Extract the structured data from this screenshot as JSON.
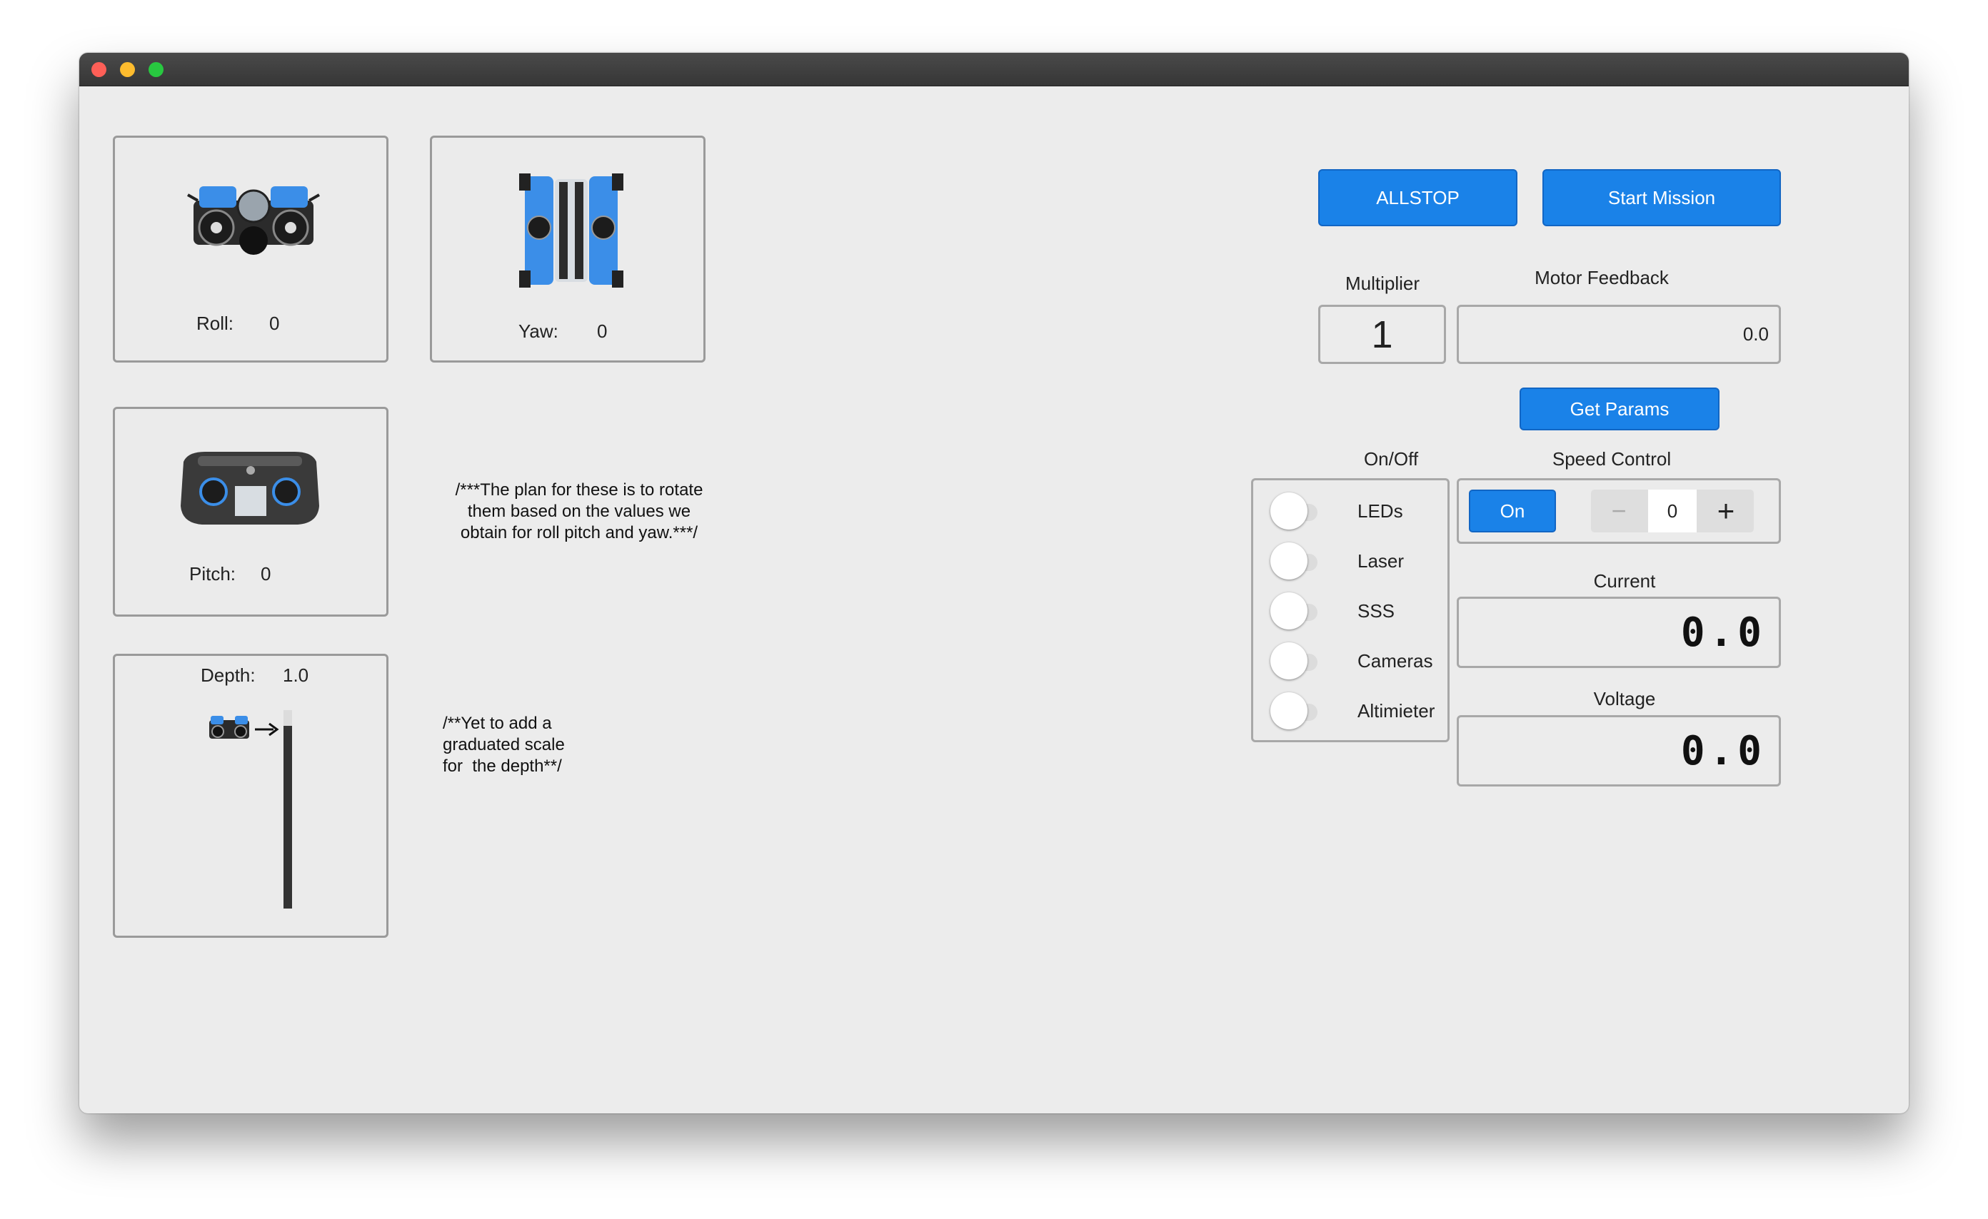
{
  "gauges": {
    "roll": {
      "label": "Roll:",
      "value": "0"
    },
    "yaw": {
      "label": "Yaw:",
      "value": "0"
    },
    "pitch": {
      "label": "Pitch:",
      "value": "0"
    },
    "depth": {
      "label": "Depth:",
      "value": "1.0"
    }
  },
  "notes": {
    "rotation_note": "/***The plan for these is to rotate\nthem based on the values we\nobtain for roll pitch and yaw.***/",
    "depth_note": "/**Yet to add a\ngraduated scale\nfor  the depth**/"
  },
  "buttons": {
    "allstop": "ALLSTOP",
    "start_mission": "Start Mission",
    "get_params": "Get Params"
  },
  "multiplier": {
    "label": "Multiplier",
    "value": "1"
  },
  "motor_feedback": {
    "label": "Motor Feedback",
    "value": "0.0"
  },
  "onoff": {
    "label": "On/Off",
    "items": [
      {
        "label": "LEDs",
        "on": false
      },
      {
        "label": "Laser",
        "on": false
      },
      {
        "label": "SSS",
        "on": false
      },
      {
        "label": "Cameras",
        "on": false
      },
      {
        "label": "Altimieter",
        "on": false
      }
    ]
  },
  "speed_control": {
    "label": "Speed Control",
    "toggle_label": "On",
    "minus": "−",
    "plus": "+",
    "value": "0"
  },
  "current": {
    "label": "Current",
    "value": "0.0"
  },
  "voltage": {
    "label": "Voltage",
    "value": "0.0"
  },
  "colors": {
    "accent": "#1a82e8",
    "rov_blue": "#3b8ee8",
    "rov_dark": "#2b2b2b"
  }
}
